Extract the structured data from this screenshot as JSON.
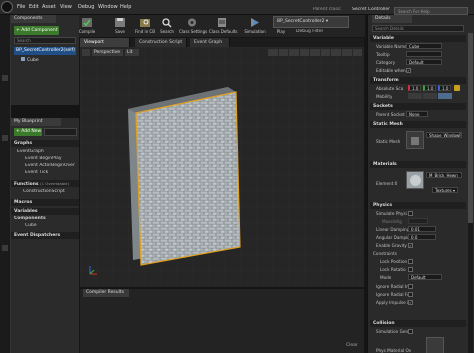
{
  "menu": [
    "File",
    "Edit",
    "Asset",
    "View",
    "Debug",
    "Window",
    "Help"
  ],
  "toolbar": {
    "buttons": [
      {
        "label": "Compile",
        "icon": "compile-icon"
      },
      {
        "label": "Save",
        "icon": "save-icon"
      },
      {
        "label": "Find in CB",
        "icon": "find-in-cb-icon"
      },
      {
        "label": "Search",
        "icon": "search-icon"
      },
      {
        "label": "Class Settings",
        "icon": "class-settings-icon"
      },
      {
        "label": "Class Defaults",
        "icon": "class-defaults-icon"
      },
      {
        "label": "Simulation",
        "icon": "simulation-icon"
      },
      {
        "label": "Play",
        "icon": "play-icon"
      }
    ],
    "debug_filter_value": "BP_SecretController2 ▾",
    "debug_filter_label": "Debug Filter",
    "parent_class_label": "Parent class:",
    "parent_class_value": "Secret Controller",
    "search_help_placeholder": "Search For Help"
  },
  "components": {
    "tab_label": "Components",
    "add_button": "+ Add Component ▾",
    "search_placeholder": "Search",
    "root_item": "BP_SecretController2(self)",
    "child_item": "Cube"
  },
  "my_blueprint": {
    "tab_label": "My Blueprint",
    "add_new_label": "+ Add New ▾",
    "graphs_header": "Graphs",
    "event_graph": "EventGraph",
    "events": [
      "Event BeginPlay",
      "Event ActorBeginOver",
      "Event Tick"
    ],
    "functions_header": "Functions",
    "functions_count": "(1 Overridable)",
    "construction_script": "ConstructionScript",
    "macros_header": "Macros",
    "variables_header": "Variables",
    "components_header": "Components",
    "components_child": "Cube",
    "dispatchers_header": "Event Dispatchers"
  },
  "viewport": {
    "tabs": [
      "Viewport",
      "Construction Script",
      "Event Graph"
    ],
    "perspective_label": "Perspective",
    "lit_label": "Lit",
    "axis_colors": {
      "x": "#d62a2a",
      "y": "#37b33b",
      "z": "#2d6bd6"
    },
    "selection_color": "#e0a020"
  },
  "compiler": {
    "tab_label": "Compiler Results",
    "clear_label": "Clear"
  },
  "details": {
    "tab_label": "Details",
    "search_placeholder": "Search Details",
    "variable": {
      "header": "Variable",
      "name_label": "Variable Name",
      "name_value": "Cube",
      "tooltip_label": "Tooltip",
      "category_label": "Category",
      "category_value": "Default",
      "editable_label": "Editable when I"
    },
    "transform": {
      "header": "Transform",
      "scale_label": "Absolute Sca",
      "scale_values": [
        "1.0",
        "1.0",
        "1.0"
      ],
      "mobility_label": "Mobility"
    },
    "sockets": {
      "header": "Sockets",
      "parent_socket_label": "Parent Socket",
      "parent_socket_value": "None"
    },
    "static_mesh": {
      "header": "Static Mesh",
      "mesh_label": "Static Mesh",
      "mesh_value": "Shape_WindowFra"
    },
    "materials": {
      "header": "Materials",
      "element_label": "Element 0",
      "material_value": "M_Brick_Hewn",
      "textures_label": "Textures ▾"
    },
    "physics": {
      "header": "Physics",
      "rows": [
        {
          "label": "Simulate Physi",
          "value": ""
        },
        {
          "label": "MassInKg",
          "value": ""
        },
        {
          "label": "Linear Damping",
          "value": "0.01"
        },
        {
          "label": "Angular Dampin",
          "value": "0.0"
        },
        {
          "label": "Enable Gravity",
          "value": ""
        }
      ],
      "constraints_header": "Constraints",
      "constraint_rows": [
        "Lock Position",
        "Lock Rotatio",
        "Mode"
      ],
      "mode_value": "Default",
      "ignore_rows": [
        "Ignore Radial Im",
        "Ignore Radial Fo",
        "Apply Impulse i"
      ]
    },
    "collision": {
      "header": "Collision",
      "rows": [
        "Simulation Gen",
        "Phys Material Ov"
      ]
    }
  }
}
